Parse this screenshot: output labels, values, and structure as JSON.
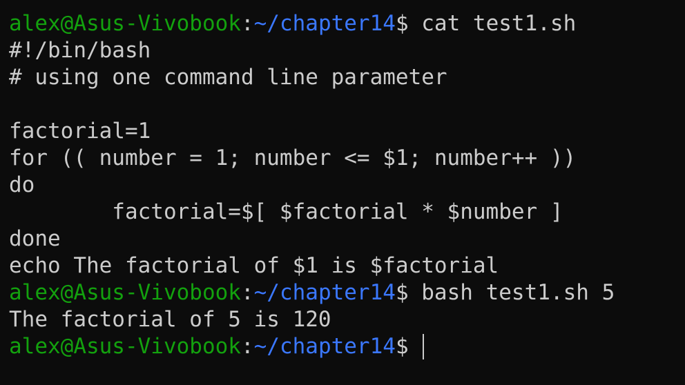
{
  "prompt": {
    "user_host": "alex@Asus-Vivobook",
    "colon": ":",
    "path": "~/chapter14",
    "symbol": "$"
  },
  "commands": [
    " cat test1.sh",
    " bash test1.sh 5",
    " "
  ],
  "script_lines": [
    "#!/bin/bash",
    "# using one command line parameter",
    "",
    "factorial=1",
    "for (( number = 1; number <= $1; number++ ))",
    "do",
    "        factorial=$[ $factorial * $number ]",
    "done",
    "echo The factorial of $1 is $factorial"
  ],
  "output_lines": [
    "The factorial of 5 is 120"
  ],
  "colors": {
    "background": "#0c0c0c",
    "text": "#cccccc",
    "user_host": "#13a10e",
    "path": "#3b78ff"
  }
}
